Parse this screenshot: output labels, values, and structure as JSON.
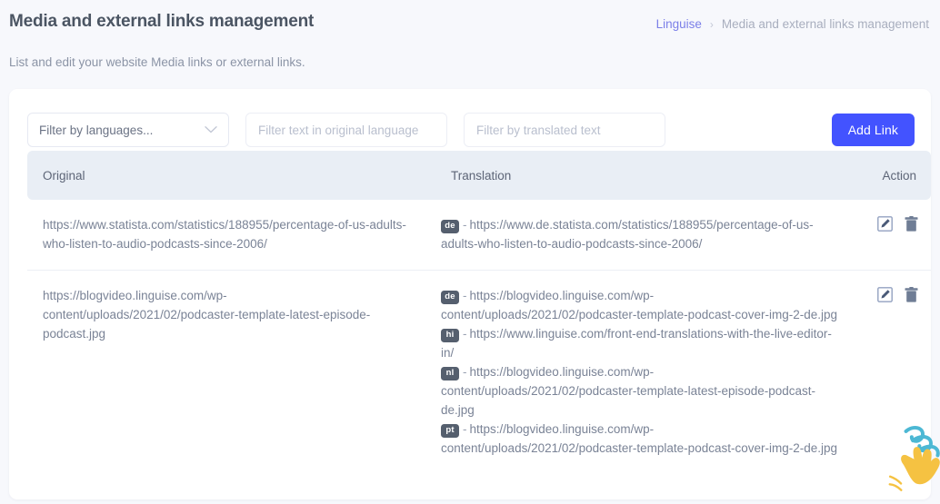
{
  "header": {
    "title": "Media and external links management",
    "subtitle": "List and edit your website Media links or external links.",
    "breadcrumb": {
      "root_label": "Linguise",
      "separator": "›",
      "current_label": "Media and external links management"
    }
  },
  "filters": {
    "language_select": {
      "label": "Filter by languages...",
      "chevron_icon": "chevron-down-icon"
    },
    "original_text_input": {
      "value": "",
      "placeholder": "Filter text in original language"
    },
    "translated_text_input": {
      "value": "",
      "placeholder": "Filter by translated text"
    },
    "add_link_button": "Add Link"
  },
  "table": {
    "columns": [
      "Original",
      "Translation",
      "Action"
    ],
    "action_icons": [
      "edit-icon",
      "delete-icon"
    ],
    "rows": [
      {
        "original": "https://www.statista.com/statistics/188955/percentage-of-us-adults-who-listen-to-audio-podcasts-since-2006/",
        "translations": [
          {
            "lang": "de",
            "dash": "-",
            "url": "https://www.de.statista.com/statistics/188955/percentage-of-us-adults-who-listen-to-audio-podcasts-since-2006/"
          }
        ]
      },
      {
        "original": "https://blogvideo.linguise.com/wp-content/uploads/2021/02/podcaster-template-latest-episode-podcast.jpg",
        "translations": [
          {
            "lang": "de",
            "dash": "-",
            "url": "https://blogvideo.linguise.com/wp-content/uploads/2021/02/podcaster-template-podcast-cover-img-2-de.jpg"
          },
          {
            "lang": "hi",
            "dash": "-",
            "url": "https://www.linguise.com/front-end-translations-with-the-live-editor-in/"
          },
          {
            "lang": "nl",
            "dash": "-",
            "url": "https://blogvideo.linguise.com/wp-content/uploads/2021/02/podcaster-template-latest-episode-podcast-de.jpg"
          },
          {
            "lang": "pt",
            "dash": "-",
            "url": "https://blogvideo.linguise.com/wp-content/uploads/2021/02/podcaster-template-podcast-cover-img-2-de.jpg"
          }
        ]
      }
    ]
  },
  "colors": {
    "page_background": "#f7f8fc",
    "accent_button": "#4353ff",
    "breadcrumb_link": "#7b7fe8",
    "table_header_background": "#e9eef5",
    "lang_badge_background": "#555f6e",
    "corner_art_yellow": "#f5c242",
    "corner_art_blue": "#4cb8d4"
  },
  "decoration": {
    "corner_illustration": "waving-hand-icon"
  }
}
